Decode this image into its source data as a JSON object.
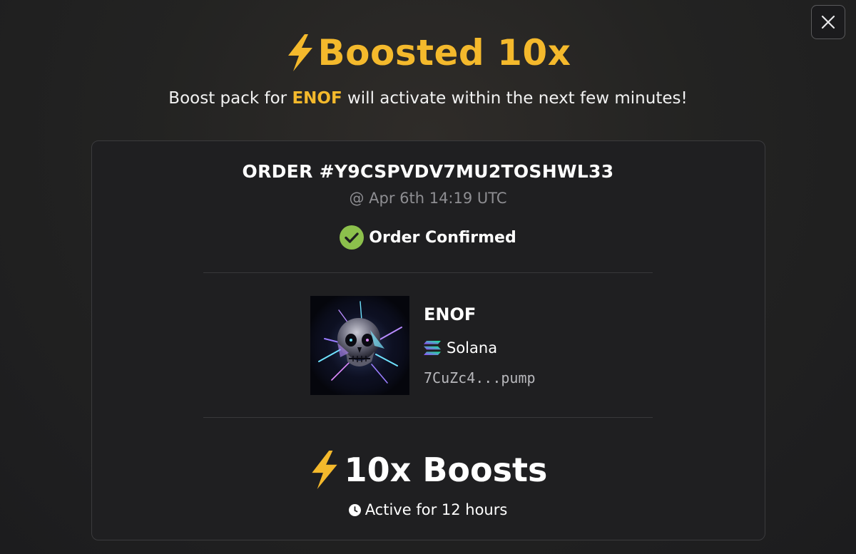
{
  "dialog": {
    "close_icon": "close-icon",
    "headline": "Boosted 10x",
    "subtitle": {
      "prefix": "Boost pack for ",
      "token": "ENOF",
      "suffix": " will activate within the next few minutes!"
    }
  },
  "order": {
    "id_text": "ORDER #Y9CSPVDV7MU2TOSHWL33",
    "timestamp": "@ Apr 6th 14:19 UTC",
    "status": "Order Confirmed",
    "status_icon": "check-circle-icon"
  },
  "token": {
    "name": "ENOF",
    "chain": "Solana",
    "chain_icon": "solana-icon",
    "address": "7CuZc4...pump",
    "image": "token-skull-image"
  },
  "boost": {
    "label": "10x Boosts",
    "duration": "Active for 12 hours",
    "duration_icon": "clock-icon"
  },
  "colors": {
    "accent": "#f4b92c",
    "success": "#8cc04c",
    "background": "#232322",
    "card": "#1f1f21"
  }
}
